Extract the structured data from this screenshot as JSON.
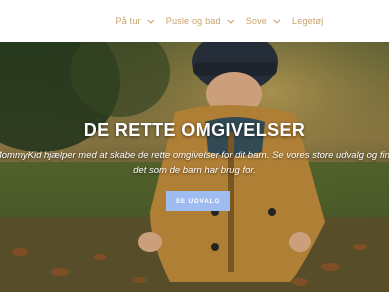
{
  "nav": {
    "items": [
      {
        "label": "På tur",
        "has_dropdown": true
      },
      {
        "label": "Pusle og bad",
        "has_dropdown": true
      },
      {
        "label": "Sove",
        "has_dropdown": true
      },
      {
        "label": "Legetøj",
        "has_dropdown": false
      }
    ],
    "color": "#c9a36a"
  },
  "hero": {
    "title": "DE RETTE OMGIVELSER",
    "text_line1": "MommyKid hjælper med at skabe de rette omgivelser for dit barn. Se vores store udvalg og find",
    "text_line2": "det som de barn har brug for.",
    "button_label": "SE UDVALG",
    "button_color": "#9fbcf0"
  }
}
